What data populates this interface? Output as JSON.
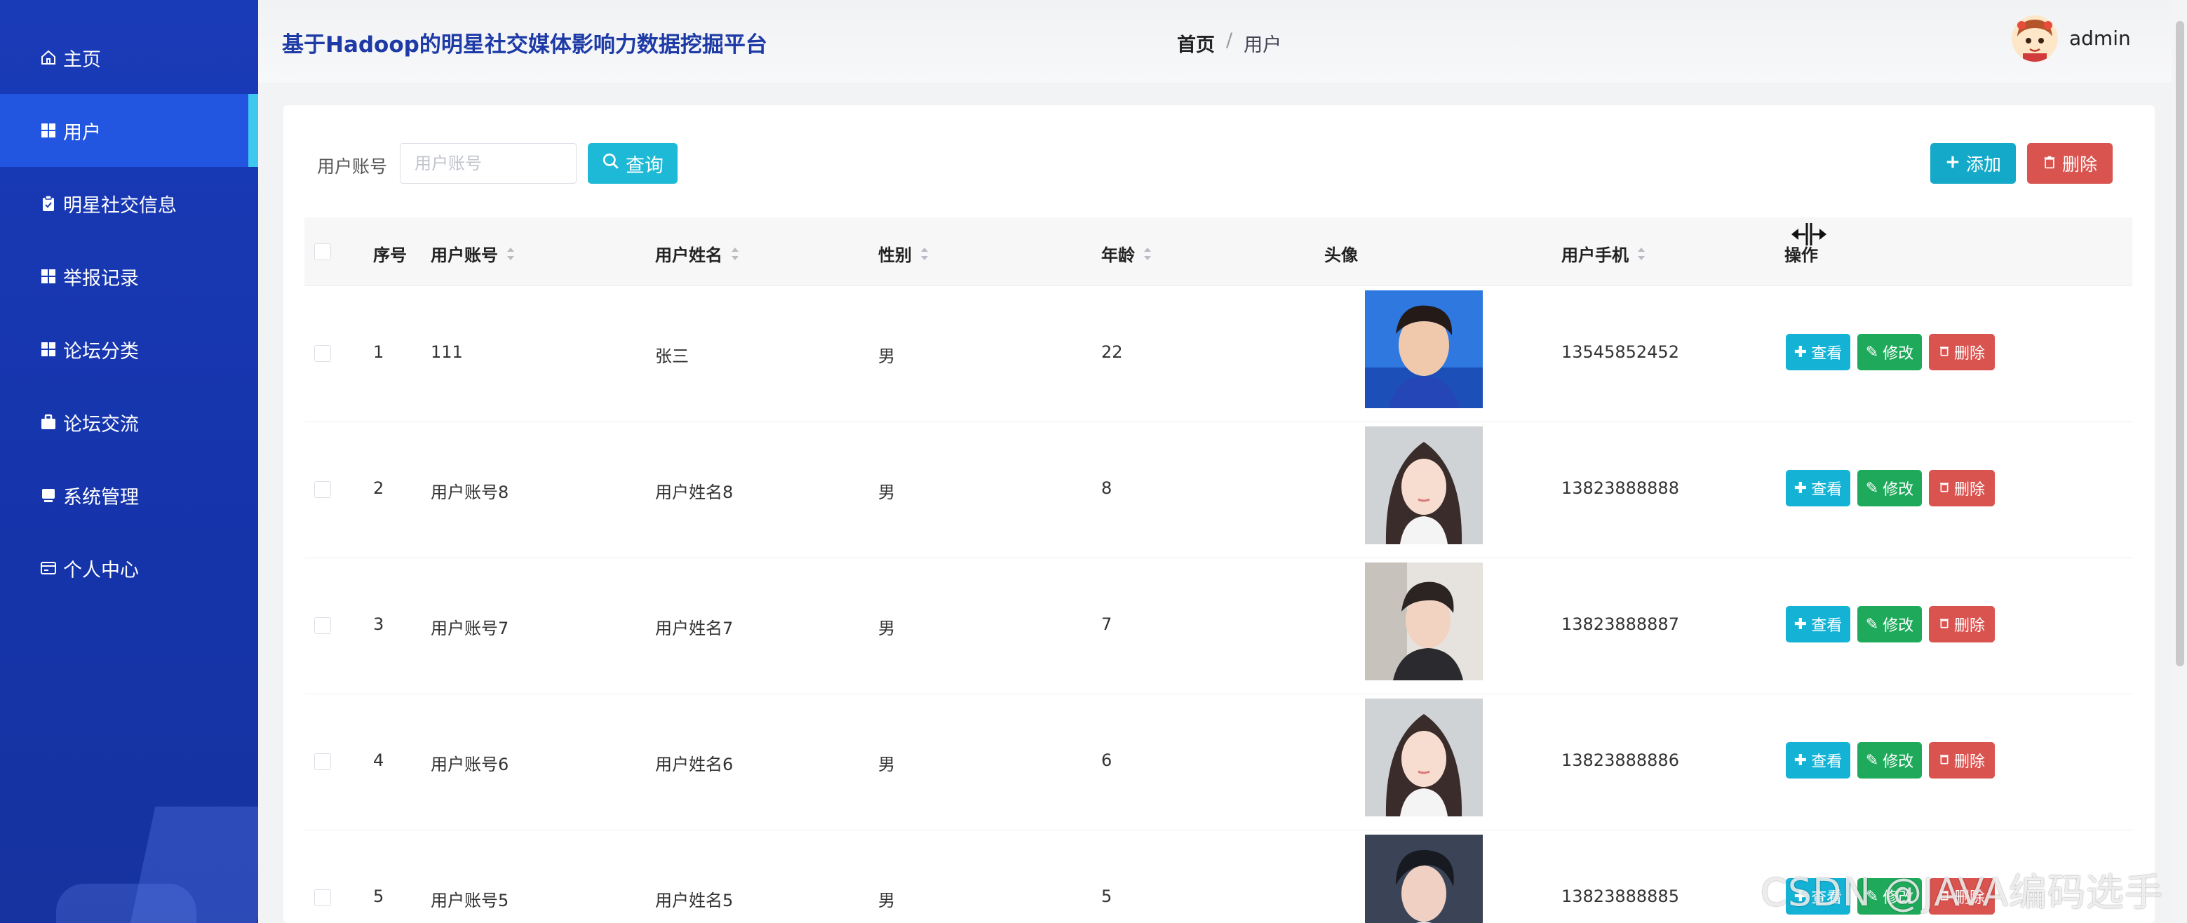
{
  "app": {
    "title": "基于Hadoop的明星社交媒体影响力数据挖掘平台",
    "username": "admin"
  },
  "breadcrumb": {
    "home": "首页",
    "separator": "/",
    "current": "用户"
  },
  "sidebar": {
    "items": [
      {
        "label": "主页",
        "icon": "home-icon",
        "active": false
      },
      {
        "label": "用户",
        "icon": "grid-icon",
        "active": true
      },
      {
        "label": "明星社交信息",
        "icon": "clipboard-icon",
        "active": false
      },
      {
        "label": "举报记录",
        "icon": "grid-icon",
        "active": false
      },
      {
        "label": "论坛分类",
        "icon": "grid-icon",
        "active": false
      },
      {
        "label": "论坛交流",
        "icon": "briefcase-icon",
        "active": false
      },
      {
        "label": "系统管理",
        "icon": "monitor-icon",
        "active": false
      },
      {
        "label": "个人中心",
        "icon": "card-icon",
        "active": false
      }
    ]
  },
  "search": {
    "label": "用户账号",
    "placeholder": "用户账号",
    "value": "",
    "query_label": "查询"
  },
  "toolbar": {
    "add_label": "添加",
    "delete_label": "删除"
  },
  "table": {
    "headers": {
      "index": "序号",
      "account": "用户账号",
      "name": "用户姓名",
      "gender": "性别",
      "age": "年龄",
      "avatar": "头像",
      "phone": "用户手机",
      "ops": "操作"
    },
    "actions": {
      "view": "查看",
      "edit": "修改",
      "delete": "删除"
    },
    "rows": [
      {
        "index": "1",
        "account": "111",
        "name": "张三",
        "gender": "男",
        "age": "22",
        "phone": "13545852452"
      },
      {
        "index": "2",
        "account": "用户账号8",
        "name": "用户姓名8",
        "gender": "男",
        "age": "8",
        "phone": "13823888888"
      },
      {
        "index": "3",
        "account": "用户账号7",
        "name": "用户姓名7",
        "gender": "男",
        "age": "7",
        "phone": "13823888887"
      },
      {
        "index": "4",
        "account": "用户账号6",
        "name": "用户姓名6",
        "gender": "男",
        "age": "6",
        "phone": "13823888886"
      },
      {
        "index": "5",
        "account": "用户账号5",
        "name": "用户姓名5",
        "gender": "男",
        "age": "5",
        "phone": "13823888885"
      }
    ]
  },
  "watermark": "CSDN @JAVA编码选手",
  "colors": {
    "sidebar": "#1a3bb8",
    "sidebar_active": "#2255e0",
    "active_indicator": "#3ec8f0",
    "title": "#1d3aa6",
    "query": "#1eb9d6",
    "view": "#14b3d6",
    "edit": "#1faa5b",
    "delete": "#d9534f"
  }
}
